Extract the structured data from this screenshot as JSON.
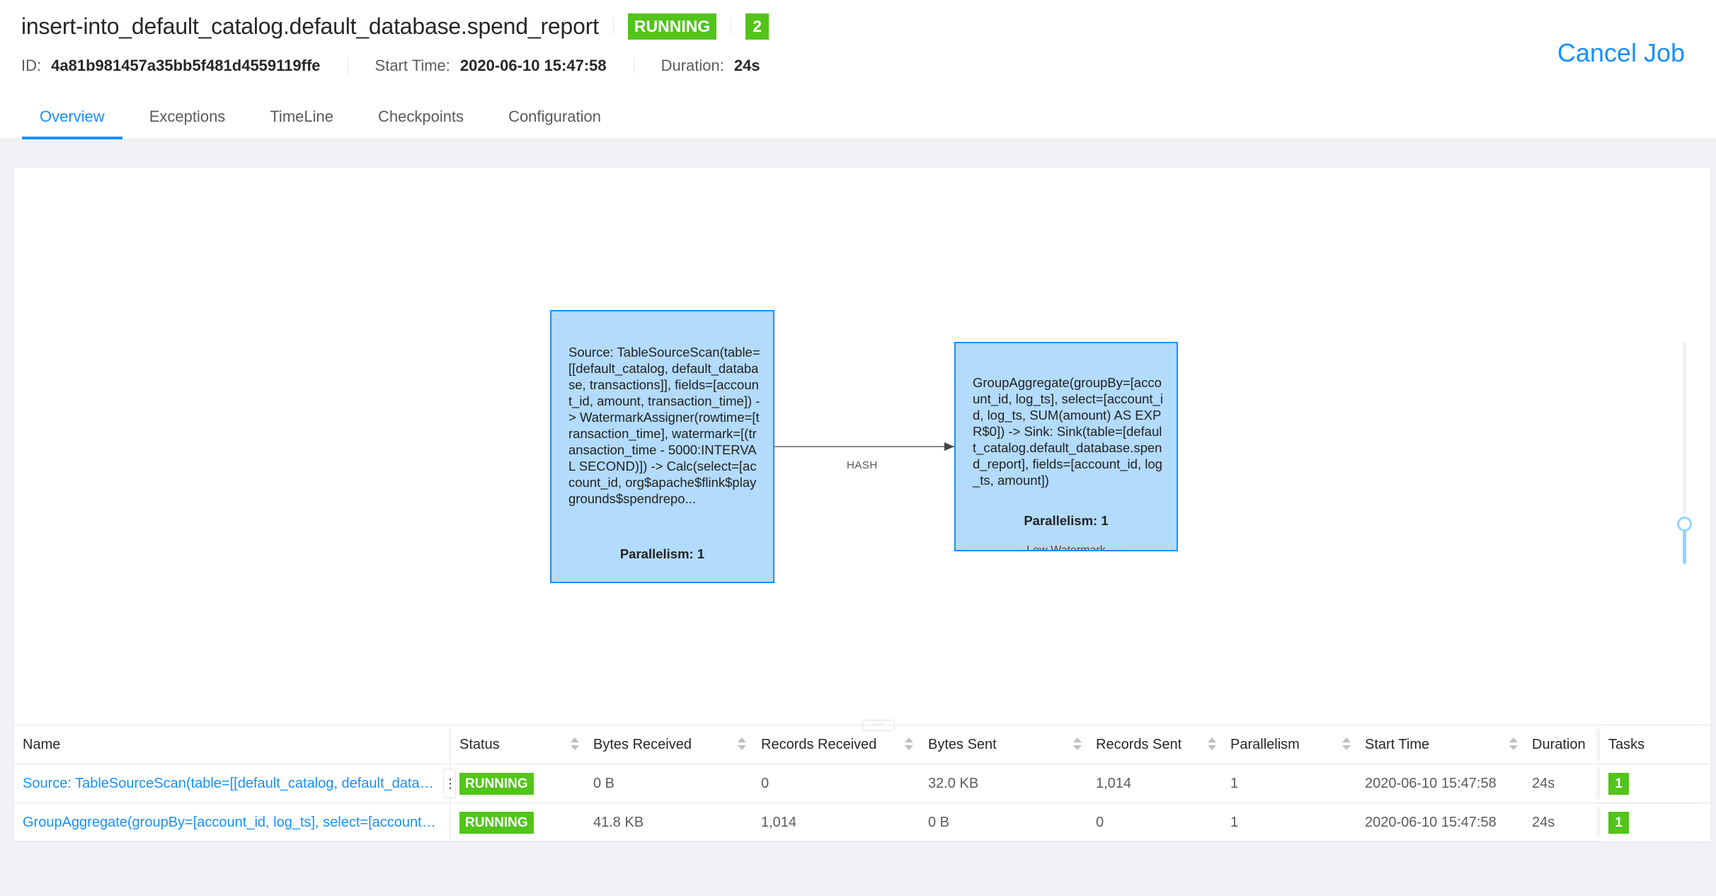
{
  "header": {
    "job_name": "insert-into_default_catalog.default_database.spend_report",
    "status": "RUNNING",
    "task_count": "2",
    "id_label": "ID:",
    "id_value": "4a81b981457a35bb5f481d4559119ffe",
    "start_time_label": "Start Time:",
    "start_time_value": "2020-06-10 15:47:58",
    "duration_label": "Duration:",
    "duration_value": "24s",
    "cancel_label": "Cancel Job"
  },
  "tabs": [
    {
      "label": "Overview",
      "active": true
    },
    {
      "label": "Exceptions",
      "active": false
    },
    {
      "label": "TimeLine",
      "active": false
    },
    {
      "label": "Checkpoints",
      "active": false
    },
    {
      "label": "Configuration",
      "active": false
    }
  ],
  "graph": {
    "nodes": [
      {
        "description": "Source: TableSourceScan(table=[[default_catalog, default_database, transactions]], fields=[account_id, amount, transaction_time]) -> WatermarkAssigner(rowtime=[transaction_time], watermark=[(transaction_time - 5000:INTERVAL SECOND)]) -> Calc(select=[account_id, org$apache$flink$playgrounds$spendrepo...",
        "parallelism": "Parallelism: 1"
      },
      {
        "description": "GroupAggregate(groupBy=[account_id, log_ts], select=[account_id, log_ts, SUM(amount) AS EXPR$0]) -> Sink: Sink(table=[default_catalog.default_database.spend_report], fields=[account_id, log_ts, amount])",
        "parallelism": "Parallelism: 1",
        "extra": "Low Watermark"
      }
    ],
    "edges": [
      {
        "from": 0,
        "to": 1,
        "label": "HASH"
      }
    ],
    "zoom_level": 0.18
  },
  "table": {
    "resize_handle": "···",
    "columns": [
      "Name",
      "Status",
      "Bytes Received",
      "Records Received",
      "Bytes Sent",
      "Records Sent",
      "Parallelism",
      "Start Time",
      "Duration",
      "Tasks"
    ],
    "rows": [
      {
        "name": "Source: TableSourceScan(table=[[default_catalog, default_database, transactions]], fields=[account_id, amount, transaction_time]) -> WatermarkAssigner(...)",
        "status": "RUNNING",
        "bytes_received": "0 B",
        "records_received": "0",
        "bytes_sent": "32.0 KB",
        "records_sent": "1,014",
        "parallelism": "1",
        "start_time": "2020-06-10 15:47:58",
        "duration": "24s",
        "tasks": "1"
      },
      {
        "name": "GroupAggregate(groupBy=[account_id, log_ts], select=[account_id, log_ts, SUM(amount) AS EXPR$0]) -> Sink: Sink(...)",
        "status": "RUNNING",
        "bytes_received": "41.8 KB",
        "records_received": "1,014",
        "bytes_sent": "0 B",
        "records_sent": "0",
        "parallelism": "1",
        "start_time": "2020-06-10 15:47:58",
        "duration": "24s",
        "tasks": "1"
      }
    ]
  },
  "colors": {
    "accent": "#1890ff",
    "running": "#52c41a",
    "node_fill": "#b3dbfb"
  }
}
